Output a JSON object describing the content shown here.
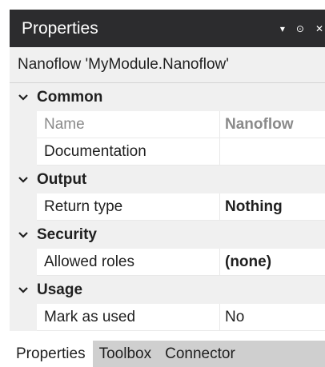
{
  "panel": {
    "title": "Properties",
    "pin_icon": "pin-icon",
    "close_icon": "close-icon"
  },
  "object": {
    "name": "Nanoflow 'MyModule.Nanoflow'"
  },
  "categories": [
    {
      "label": "Common",
      "rows": [
        {
          "name": "Name",
          "value": "Nanoflow"
        },
        {
          "name": "Documentation",
          "value": ""
        }
      ]
    },
    {
      "label": "Output",
      "rows": [
        {
          "name": "Return type",
          "value": "Nothing"
        }
      ]
    },
    {
      "label": "Security",
      "rows": [
        {
          "name": "Allowed roles",
          "value": "(none)"
        }
      ]
    },
    {
      "label": "Usage",
      "rows": [
        {
          "name": "Mark as used",
          "value": "No"
        }
      ]
    }
  ],
  "tabs": [
    "Properties",
    "Toolbox",
    "Connector"
  ],
  "active_tab": "Properties",
  "colors": {
    "titlebar": "#2c2c2e",
    "header_bg": "#f0f0f0",
    "tab_strip": "#cfcfcf",
    "disabled_text": "#8a8a8a"
  }
}
